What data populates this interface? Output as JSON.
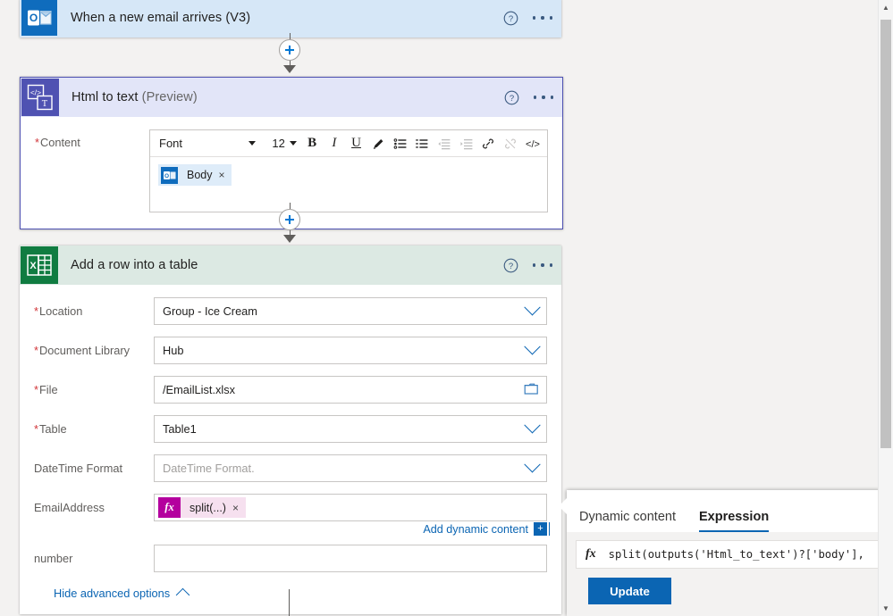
{
  "trigger": {
    "title": "When a new email arrives (V3)",
    "icon": "outlook-icon",
    "help_icon": "help-icon",
    "more_icon": "more-options-icon"
  },
  "html_to_text": {
    "title": "Html to text",
    "title_suffix": "(Preview)",
    "icon": "html-to-text-icon",
    "content_label": "Content",
    "required_marker": "*",
    "toolbar": {
      "font_label": "Font",
      "size_label": "12",
      "bold": "B",
      "italic": "I",
      "underline": "U",
      "highlight_icon": "highlighter-icon",
      "bullet_list_icon": "bulleted-list-icon",
      "numbered_list_icon": "numbered-list-icon",
      "outdent_icon": "decrease-indent-icon",
      "indent_icon": "increase-indent-icon",
      "link_icon": "insert-link-icon",
      "unlink_icon": "remove-link-icon",
      "code_icon": "code-view-icon"
    },
    "content_token": {
      "label": "Body",
      "icon": "outlook-icon",
      "remove": "×"
    }
  },
  "excel": {
    "title": "Add a row into a table",
    "icon": "excel-icon",
    "fields": [
      {
        "label": "Location",
        "required": true,
        "value": "Group - Ice Cream",
        "control": "dropdown",
        "placeholder": false
      },
      {
        "label": "Document Library",
        "required": true,
        "value": "Hub",
        "control": "dropdown",
        "placeholder": false
      },
      {
        "label": "File",
        "required": true,
        "value": "/EmailList.xlsx",
        "control": "filepicker",
        "placeholder": false
      },
      {
        "label": "Table",
        "required": true,
        "value": "Table1",
        "control": "dropdown",
        "placeholder": false
      },
      {
        "label": "DateTime Format",
        "required": false,
        "value": "DateTime Format.",
        "control": "dropdown",
        "placeholder": true
      }
    ],
    "email_address": {
      "label": "EmailAddress",
      "token_label": "split(...)",
      "token_icon": "fx-icon",
      "token_fx": "fx",
      "remove": "×"
    },
    "add_dynamic_content": {
      "label": "Add dynamic content",
      "badge": "+"
    },
    "number": {
      "label": "number",
      "value": ""
    },
    "hide_advanced": {
      "label": "Hide advanced options",
      "icon": "chevron-up-icon"
    }
  },
  "expression_panel": {
    "tabs": [
      {
        "label": "Dynamic content",
        "active": false
      },
      {
        "label": "Expression",
        "active": true
      }
    ],
    "fx_symbol": "fx",
    "expression": "split(outputs('Html_to_text')?['body'],",
    "update_button": "Update"
  },
  "scrollbar": {
    "up": "▲",
    "down": "▼"
  },
  "colors": {
    "trigger_header": "#d6e7f7",
    "html_header": "#e2e5f8",
    "excel_header": "#dce9e3",
    "accent_blue": "#0b65b3",
    "required_red": "#d13438",
    "fx_magenta": "#b4009e",
    "selected_border": "#4f52b2"
  }
}
